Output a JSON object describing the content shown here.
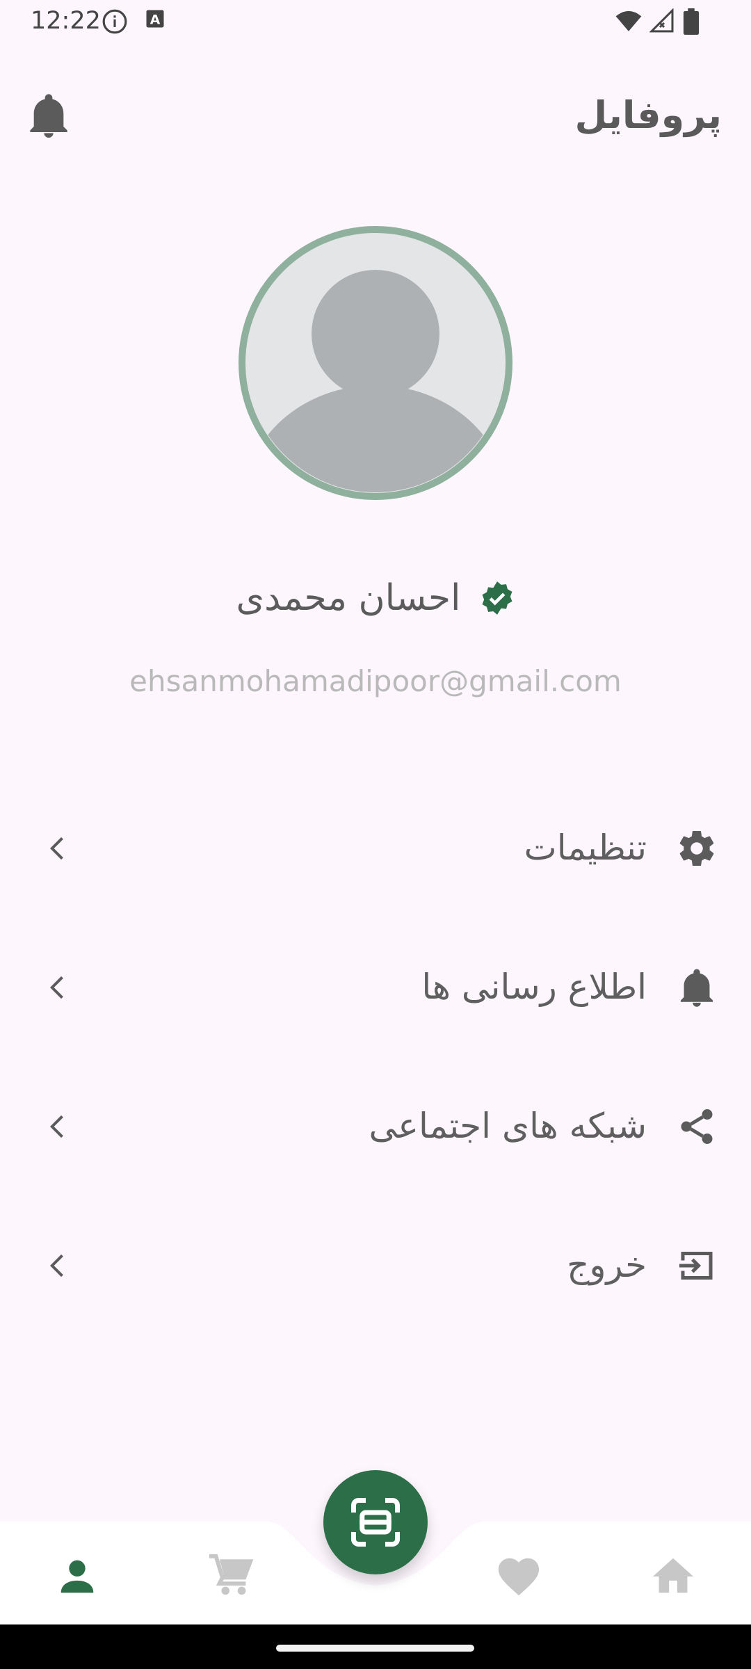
{
  "status_bar": {
    "time": "12:22",
    "icons": [
      "info-icon",
      "a-box-icon",
      "wifi-icon",
      "signal-icon",
      "battery-icon"
    ]
  },
  "header": {
    "title": "پروفایل",
    "bell_icon": "bell-icon"
  },
  "profile": {
    "name": "احسان محمدی",
    "email": "ehsanmohamadipoor@gmail.com",
    "verified_icon": "verified-badge-icon",
    "avatar_icon": "default-avatar"
  },
  "menu": {
    "items": [
      {
        "label": "تنظیمات",
        "icon": "gear-icon"
      },
      {
        "label": "اطلاع رسانی ها",
        "icon": "bell-icon"
      },
      {
        "label": "شبکه های اجتماعی",
        "icon": "share-icon"
      },
      {
        "label": "خروج",
        "icon": "exit-icon"
      }
    ]
  },
  "bottom_nav": {
    "items": [
      "person-icon",
      "cart-icon",
      "scan-icon",
      "heart-icon",
      "home-icon"
    ],
    "active": "person-icon"
  },
  "colors": {
    "accent": "#2c6e47",
    "background": "#fdf7fd",
    "inactive_icon": "#c7c7c7",
    "text": "#5f5f5f",
    "avatar_ring": "#8fb09d"
  }
}
